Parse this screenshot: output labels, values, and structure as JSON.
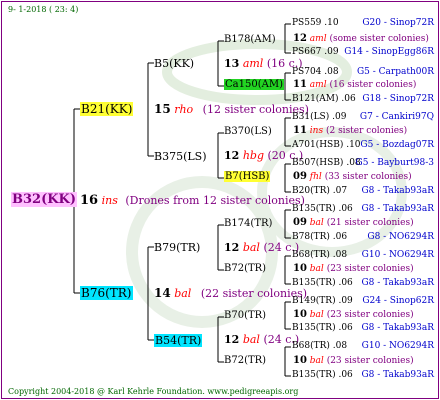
{
  "header": {
    "date_line": "9-  1-2018 ( 23: 4)"
  },
  "footer": {
    "copyright": "Copyright 2004-2018 @ Karl Kehrle Foundation.   www.pedigreeapis.org"
  },
  "root": {
    "id": "B32(KK)",
    "count": "16",
    "ins": "ins",
    "note": "(Drones from 12 sister colonies)"
  },
  "gen1": [
    {
      "id": "B21(KK)",
      "count": "15",
      "name": "rho",
      "note": "(12 sister colonies)"
    },
    {
      "id": "B76(TR)",
      "count": "14",
      "name": "bal",
      "note": "(22 sister colonies)"
    }
  ],
  "gen2": [
    {
      "id": "B5(KK)",
      "count": "13",
      "name": "aml",
      "note": "(16 c.)"
    },
    {
      "id": "B375(LS)",
      "count": "12",
      "name": "hbg",
      "note": "(20 c.)"
    },
    {
      "id": "B79(TR)",
      "count": "12",
      "name": "bal",
      "note": "(24 c.)"
    },
    {
      "id": "B54(TR)",
      "count": "12",
      "name": "bal",
      "note": "(24 c.)"
    }
  ],
  "gen3": [
    {
      "id": "B178(AM)",
      "count": "12",
      "name": "aml",
      "note": "(some sister colonies)"
    },
    {
      "id": "Ca150(AM)",
      "count": "11",
      "name": "aml",
      "note": "(16 sister colonies)"
    },
    {
      "id": "B370(LS)",
      "count": "11",
      "name": "ins",
      "note": "(2 sister colonies)"
    },
    {
      "id": "B7(HSB)",
      "count": "09",
      "name": "fhl",
      "note": "(33 sister colonies)"
    },
    {
      "id": "B174(TR)",
      "count": "09",
      "name": "bal",
      "note": "(21 sister colonies)"
    },
    {
      "id": "B72(TR)",
      "count": "10",
      "name": "bal",
      "note": "(23 sister colonies)"
    },
    {
      "id": "B70(TR)",
      "count": "10",
      "name": "bal",
      "note": "(23 sister colonies)"
    },
    {
      "id": "B72(TR)",
      "count": "10",
      "name": "bal",
      "note": "(23 sister colonies)"
    }
  ],
  "gen4": [
    {
      "id": "PS559",
      "yr": ".10",
      "sire": "G20 - Sinop72R"
    },
    {
      "id": "PS667",
      "yr": ".09",
      "sire": "G14 - SinopEgg86R"
    },
    {
      "id": "PS704",
      "yr": ".08",
      "sire": "G5 - Carpath00R"
    },
    {
      "id": "B121(AM)",
      "yr": ".06",
      "sire": "G18 - Sinop72R"
    },
    {
      "id": "B31(LS)",
      "yr": ".09",
      "sire": "G7 - Cankiri97Q"
    },
    {
      "id": "A701(HSB)",
      "yr": ".10",
      "sire": "G5 - Bozdag07R"
    },
    {
      "id": "B507(HSB)",
      "yr": ".08",
      "sire": "G5 - Bayburt98-3"
    },
    {
      "id": "B20(TR)",
      "yr": ".07",
      "sire": "G8 - Takab93aR"
    },
    {
      "id": "B135(TR)",
      "yr": ".06",
      "sire": "G8 - Takab93aR"
    },
    {
      "id": "B78(TR)",
      "yr": ".06",
      "sire": "G8 - NO6294R"
    },
    {
      "id": "B68(TR)",
      "yr": ".08",
      "sire": "G10 - NO6294R"
    },
    {
      "id": "B135(TR)",
      "yr": ".06",
      "sire": "G8 - Takab93aR"
    },
    {
      "id": "B149(TR)",
      "yr": ".09",
      "sire": "G24 - Sinop62R"
    },
    {
      "id": "B135(TR)",
      "yr": ".06",
      "sire": "G8 - Takab93aR"
    },
    {
      "id": "B68(TR)",
      "yr": ".08",
      "sire": "G10 - NO6294R"
    },
    {
      "id": "B135(TR)",
      "yr": ".06",
      "sire": "G8 - Takab93aR"
    }
  ],
  "colors": {
    "border": "#800080",
    "root_bg": "#ffc0ff",
    "yellow_bg": "#ffff33",
    "cyan_bg": "#00e5ff",
    "green_bg": "#22d422",
    "red": "#ff0000",
    "blue": "#0000cc",
    "purple": "#800080"
  }
}
